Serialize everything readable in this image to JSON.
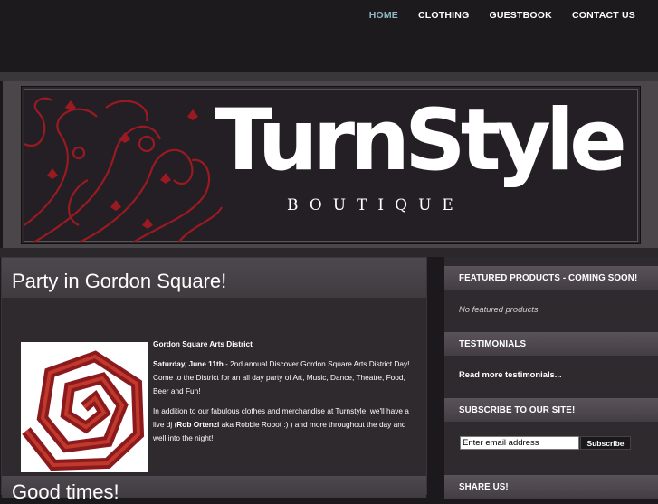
{
  "nav": {
    "items": [
      {
        "label": "HOME",
        "active": true
      },
      {
        "label": "CLOTHING"
      },
      {
        "label": "GUESTBOOK"
      },
      {
        "label": "CONTACT US"
      }
    ]
  },
  "banner": {
    "logo_title": "TurnStyle",
    "logo_subtitle": "BOUTIQUE"
  },
  "post": {
    "title": "Party in Gordon Square!",
    "heading": "Gordon Square Arts District",
    "date": "Saturday, June 11th",
    "intro_rest": " - 2nd annual Discover Gordon Square Arts District Day! Come to the District for an all day party of Art, Music, Dance, Theatre, Food, Beer and Fun!",
    "para2_start": "In addition to our fabulous clothes and merchandise at Turnstyle, we'll have a live dj (",
    "dj_name": "Rob Ortenzi",
    "para2_end": " aka Robbie Robot :) ) and more throughout the day and well into the night!"
  },
  "post2": {
    "title": "Good times!"
  },
  "sidebar": {
    "featured_heading": "FEATURED PRODUCTS - COMING SOON!",
    "featured_empty": "No featured products",
    "testimonials_heading": "TESTIMONIALS",
    "testimonials_link": "Read more testimonials...",
    "subscribe_heading": "SUBSCRIBE TO OUR SITE!",
    "email_value": "Enter email address",
    "subscribe_button": "Subscribe",
    "share_heading": "SHARE US!"
  },
  "colors": {
    "accent_nav_active": "#8fb8c0",
    "swirl_red": "#9b1a22"
  }
}
